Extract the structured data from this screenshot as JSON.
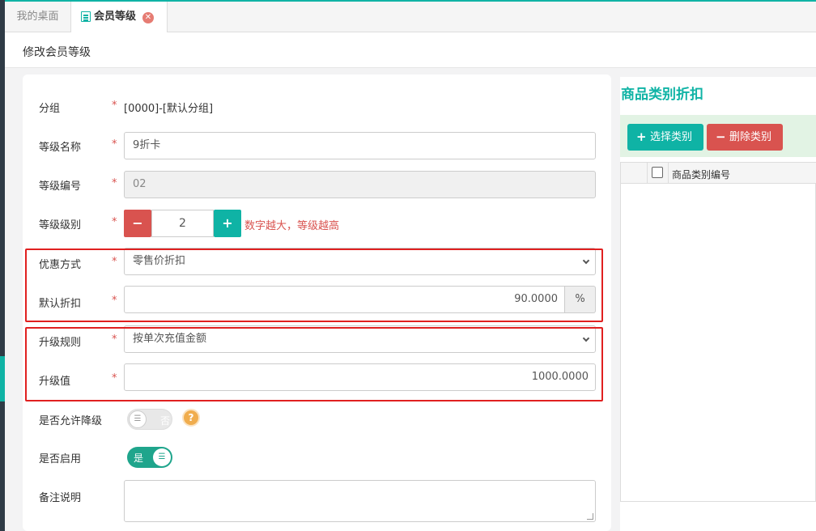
{
  "tabs": {
    "home_label": "我的桌面",
    "active_label": "会员等级",
    "close_glyph": "✕"
  },
  "page": {
    "title": "修改会员等级"
  },
  "form": {
    "required_mark": "*",
    "group": {
      "label": "分组",
      "value": "[0000]-[默认分组]"
    },
    "level_name": {
      "label": "等级名称",
      "value": "9折卡"
    },
    "level_code": {
      "label": "等级编号",
      "value": "02"
    },
    "level_rank": {
      "label": "等级级别",
      "value": "2",
      "minus": "−",
      "plus": "+",
      "hint": "数字越大，等级越高"
    },
    "discount_mode": {
      "label": "优惠方式",
      "value": "零售价折扣"
    },
    "default_discount": {
      "label": "默认折扣",
      "value": "90.0000",
      "unit": "%"
    },
    "upgrade_rule": {
      "label": "升级规则",
      "value": "按单次充值金额"
    },
    "upgrade_value": {
      "label": "升级值",
      "value": "1000.0000"
    },
    "allow_downgrade": {
      "label": "是否允许降级",
      "state": "否",
      "help": "?"
    },
    "enabled": {
      "label": "是否启用",
      "state": "是"
    },
    "remark": {
      "label": "备注说明",
      "value": ""
    }
  },
  "category_panel": {
    "title": "商品类别折扣",
    "add_button": "选择类别",
    "delete_button": "删除类别",
    "add_icon": "+",
    "delete_icon": "−",
    "table_header": {
      "code": "商品类别编号"
    }
  },
  "colors": {
    "accent": "#0fb3a5",
    "danger": "#d9534f",
    "highlight_box": "#e02020"
  }
}
